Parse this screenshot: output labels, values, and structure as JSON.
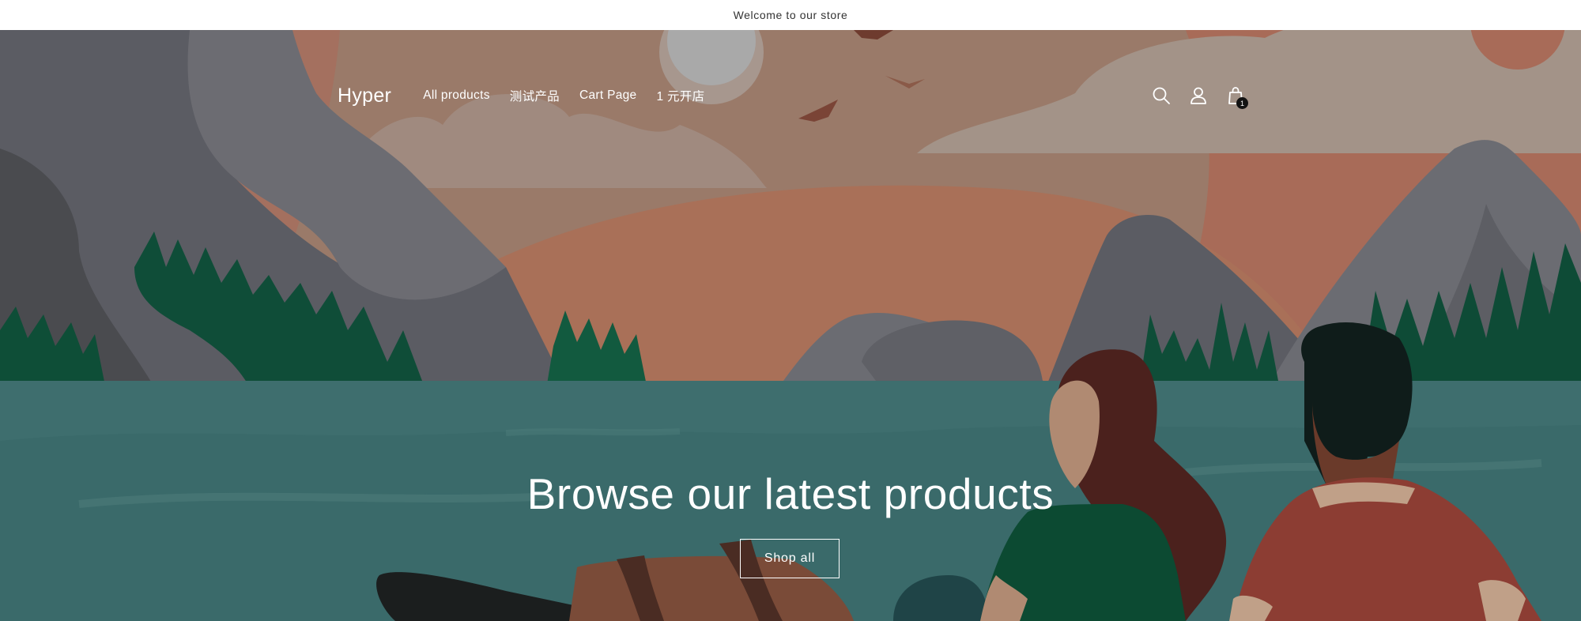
{
  "announcement": {
    "text": "Welcome to our store"
  },
  "header": {
    "logo": "Hyper",
    "nav": [
      {
        "label": "All products"
      },
      {
        "label": "测试产品"
      },
      {
        "label": "Cart Page"
      },
      {
        "label": "1 元开店"
      }
    ],
    "icons": [
      "search-icon",
      "account-icon",
      "cart-icon"
    ],
    "cart_count": "1"
  },
  "hero": {
    "title": "Browse our latest products",
    "button_label": "Shop all"
  },
  "colors": {
    "sky": "#9b7a6a",
    "water": "#3e6e6e",
    "mountain": "#5b5c63",
    "trees": "#0f4d38",
    "badge": "#121212"
  }
}
